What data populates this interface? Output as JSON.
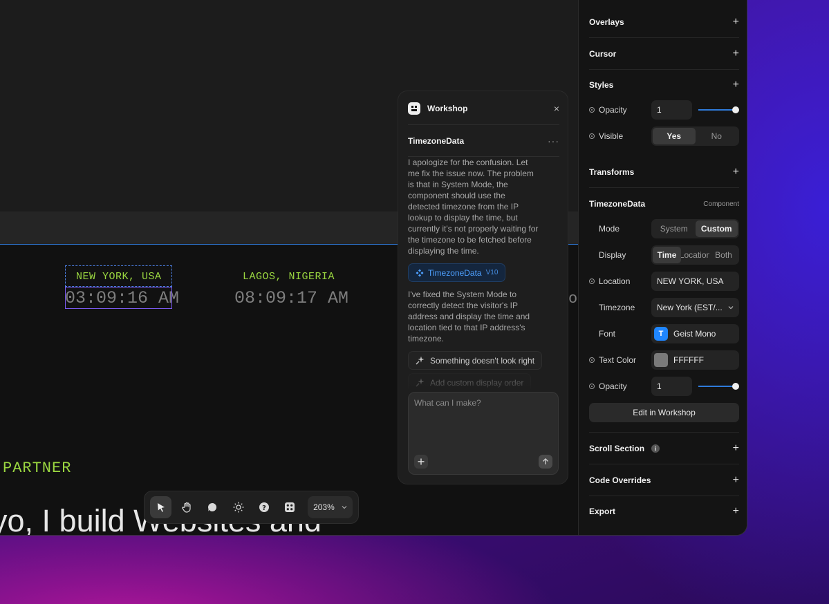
{
  "canvas": {
    "cities": [
      {
        "city": "NEW YORK, USA",
        "time": "03:09:16 AM"
      },
      {
        "city": "LAGOS, NIGERIA",
        "time": "08:09:17 AM"
      }
    ],
    "edge_glyph": "o",
    "partner": "PARTNER",
    "hero": "yo, I build Websites and"
  },
  "toolbar": {
    "zoom": "203%"
  },
  "workshop": {
    "title": "Workshop",
    "close": "×",
    "subtitle": "TimezoneData",
    "more": "···",
    "message_1": "I apologize for the confusion. Let me fix the issue now. The problem is that in System Mode, the component should use the detected timezone from the IP lookup to display the time, but currently it's not properly waiting for the timezone to be fetched before displaying the time.",
    "chip_label": "TimezoneData",
    "chip_version": "V10",
    "message_2": "I've fixed the System Mode to correctly detect the visitor's IP address and display the time and location tied to that IP address's timezone.",
    "suggestion_1": "Something doesn't look right",
    "suggestion_2": "Add custom display order",
    "prompt_placeholder": "What can I make?"
  },
  "panel": {
    "overlays": "Overlays",
    "cursor": "Cursor",
    "styles": "Styles",
    "opacity_label": "Opacity",
    "opacity_value": "1",
    "opacity_level": 1,
    "visible_label": "Visible",
    "visible_yes": "Yes",
    "visible_no": "No",
    "transforms": "Transforms",
    "component_name": "TimezoneData",
    "component_tag": "Component",
    "mode_label": "Mode",
    "mode_system": "System",
    "mode_custom": "Custom",
    "display_label": "Display",
    "display_time": "Time",
    "display_location": "Location",
    "display_both": "Both",
    "location_label": "Location",
    "location_value": "NEW YORK, USA",
    "timezone_label": "Timezone",
    "timezone_value": "New York (EST/...",
    "font_label": "Font",
    "font_value": "Geist Mono",
    "text_color_label": "Text Color",
    "text_color_value": "FFFFFF",
    "opacity2_label": "Opacity",
    "opacity2_value": "1",
    "opacity2_level": 1,
    "edit_button": "Edit in Workshop",
    "scroll_section": "Scroll Section",
    "code_overrides": "Code Overrides",
    "export": "Export"
  }
}
